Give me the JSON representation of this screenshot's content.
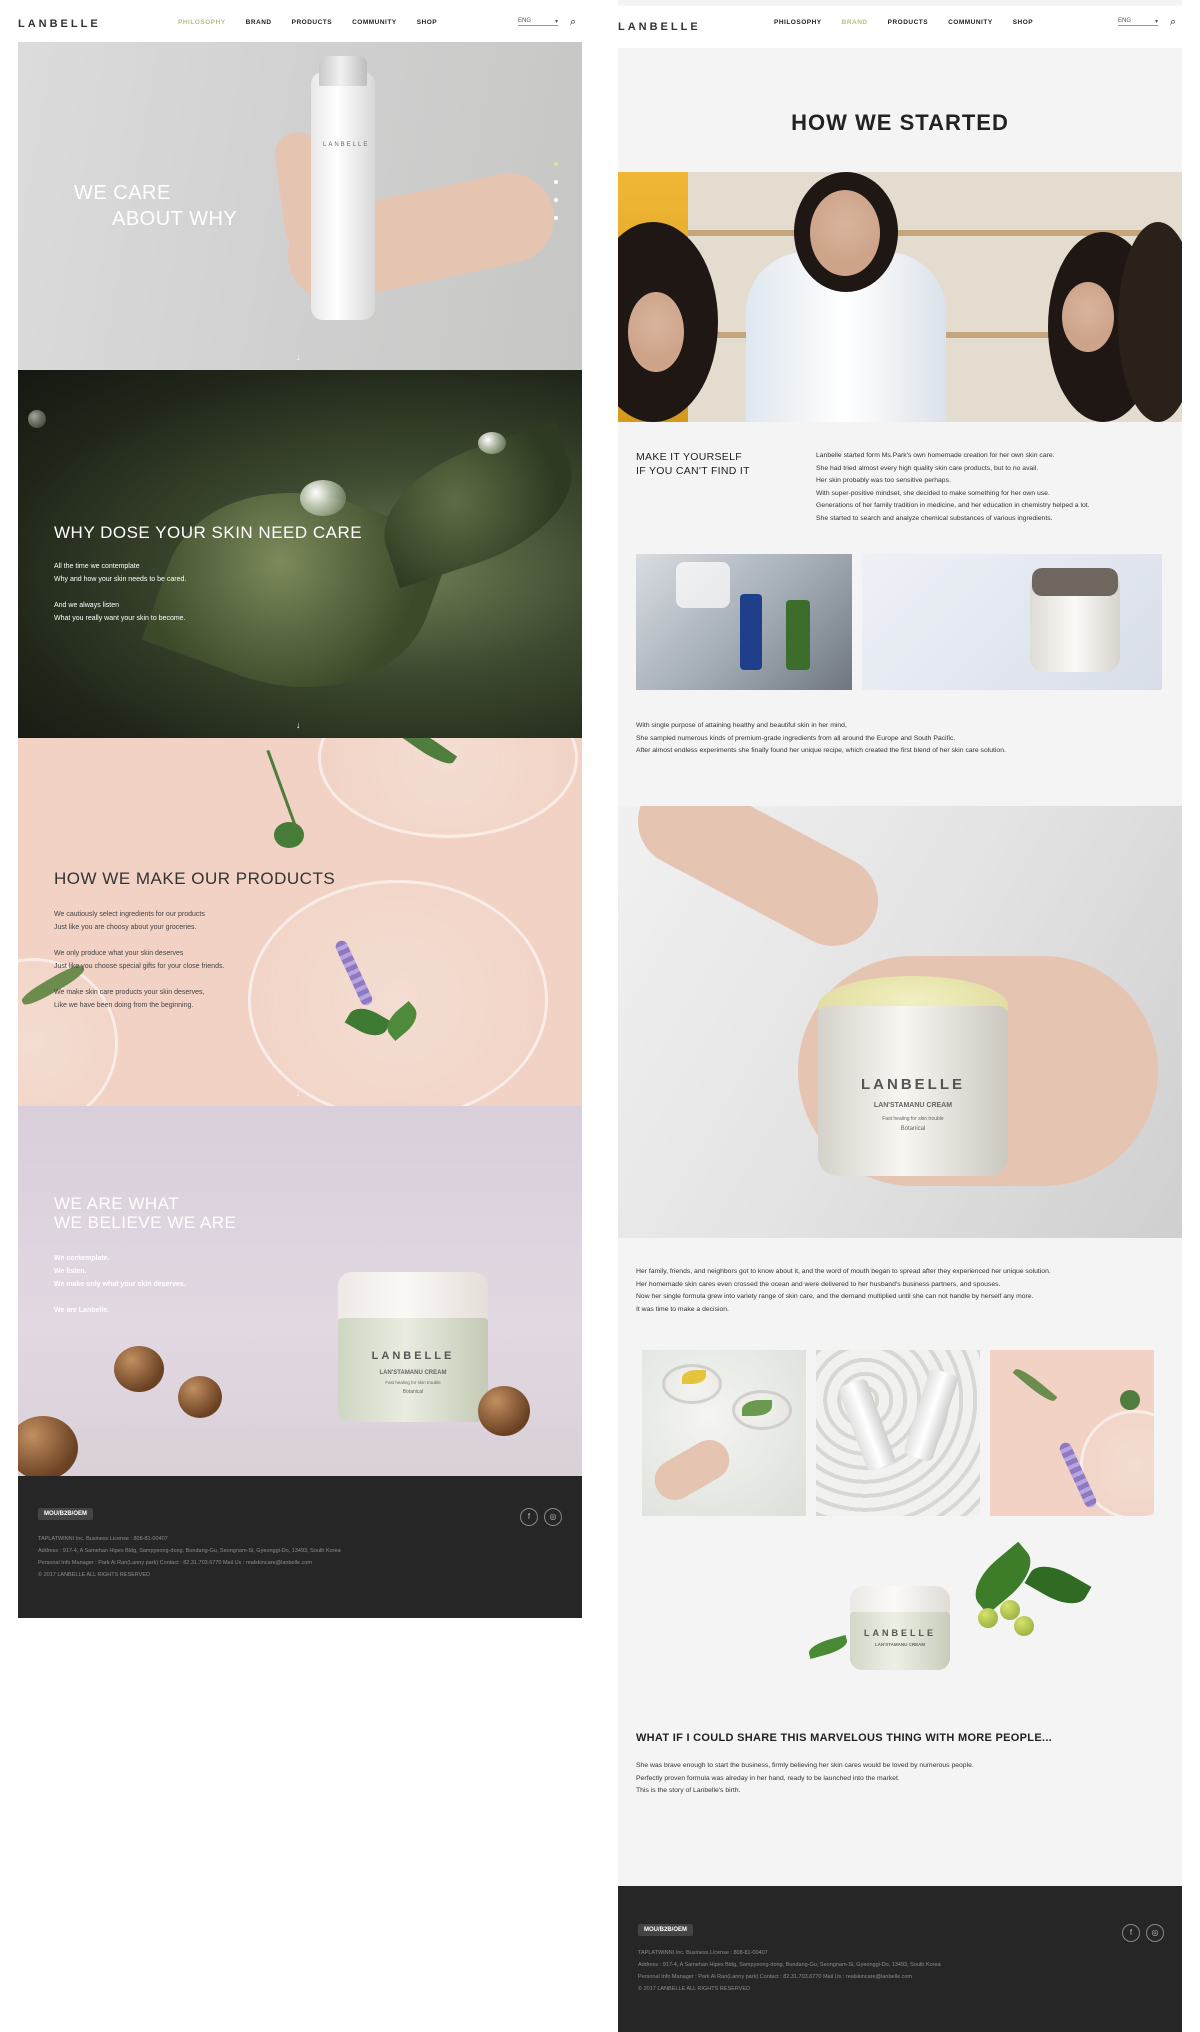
{
  "left": {
    "header": {
      "logo": "LANBELLE",
      "nav": [
        "PHILOSOPHY",
        "BRAND",
        "PRODUCTS",
        "COMMUNITY",
        "SHOP"
      ],
      "active_nav": "PHILOSOPHY",
      "lang": "ENG",
      "lang_caret": "▾",
      "search_icon": "⌕"
    },
    "hero": {
      "title_line1": "WE CARE",
      "title_line2": "ABOUT WHY",
      "bottle_brand": "LANBELLE",
      "scroll_arrow": "↓"
    },
    "why": {
      "title": "WHY DOSE YOUR SKIN NEED CARE",
      "lines": [
        "All the time we contemplate",
        "Why and how your skin needs to be cared.",
        "",
        "And we always listen",
        "What you really want your skin to become."
      ],
      "scroll_arrow": "↓"
    },
    "make": {
      "title": "HOW WE MAKE OUR PRODUCTS",
      "lines": [
        "We cautiously select ingredients for our products",
        "Just like you are choosy about your groceries.",
        "",
        "We only produce what your skin deserves",
        "Just like you choose special gifts for your close friends.",
        "",
        "We make skin care products your skin deserves,",
        "Like we have been doing from the beginning."
      ],
      "scroll_arrow": "↓"
    },
    "believe": {
      "title_line1": "WE ARE WHAT",
      "title_line2": "WE BELIEVE WE ARE",
      "lines": [
        "We contemplate.",
        "We listen.",
        "We make only what your skin deserves.",
        "",
        "We are Lanbelle."
      ],
      "jar_brand": "LANBELLE",
      "jar_name": "LAN'STAMANU CREAM",
      "jar_sub": "Fast healing for skin trouble",
      "jar_tag": "Botanical"
    },
    "footer": {
      "badge": "MOU/B2B/OEM",
      "line1": "TAPLATWINNI Inc.     Business License : 808-81-00407",
      "line2": "Address : 917-4, A Samehan Hipex Bldg, Sampyeong-dong, Bundang-Gu, Seongnam-Si, Gyeonggi-Do, 13493, South Korea",
      "line3": "Personal Info Manager : Park Ai Ran(Lanny park)     Contact : 82.31.703.6770     Mail Us : realskincare@lanbelle.com",
      "line4": "© 2017 LANBELLE ALL RIGHTS RESERVED",
      "social1": "f",
      "social2": "◎"
    }
  },
  "right": {
    "header": {
      "logo": "LANBELLE",
      "nav": [
        "PHILOSOPHY",
        "BRAND",
        "PRODUCTS",
        "COMMUNITY",
        "SHOP"
      ],
      "active_nav": "BRAND",
      "lang": "ENG",
      "lang_caret": "▾",
      "search_icon": "⌕"
    },
    "title": "HOW WE STARTED",
    "make_heading_line1": "MAKE IT YOURSELF",
    "make_heading_line2": "IF YOU CAN'T FIND IT",
    "intro_lines": [
      "Lanbelle started form Ms.Park's own homemade creation for her own skin care.",
      "She had tried almost every high quality skin care products, but to no avail.",
      "Her skin probably was too sensitive perhaps.",
      "With super-positive mindset, she decided to make something for her own use.",
      "Generations of her family tradition in medicine, and her education in chemistry helped a lot.",
      "She started to search and analyze chemical substances of various ingredients."
    ],
    "purpose_lines": [
      "With single purpose of attaining healthy and beautiful skin in her mind,",
      "She sampled numerous kinds of premium-grade ingredients from all around the Europe and South Pacific.",
      "After almost endless experiments she finally found her unique recipe, which created the first blend of her skin care solution."
    ],
    "big_jar": {
      "brand": "LANBELLE",
      "name": "LAN'STAMANU CREAM",
      "sub": "Fast healing for skin trouble",
      "tag": "Botanical"
    },
    "spread_lines": [
      "Her family, friends, and neighbors got to know about it, and the word of mouth began to spread after they experienced her unique solution.",
      "Her homemade skin cares even crossed the ocean and were delivered to her husband's business partners, and spouses.",
      "Now her single formula grew into variety range of skin care, and the demand multiplied until she can not handle by herself any more.",
      "It was time to make a decision."
    ],
    "small_jar": {
      "brand": "LANBELLE",
      "name": "LAN'STAMANU CREAM"
    },
    "share_heading": "WHAT IF I COULD SHARE THIS MARVELOUS THING WITH MORE PEOPLE...",
    "share_lines": [
      "She was brave enough to start the business, firmly believing her skin cares would be loved by numerous people.",
      "Perfectly proven formula was alreday in her hand, ready to be launched into the market.",
      "This is the story of Lanbelle's birth."
    ],
    "footer": {
      "badge": "MOU/B2B/OEM",
      "line1": "TAPLATWINNI Inc.     Business License : 808-81-00407",
      "line2": "Address : 917-4, A Samehan Hipex Bldg, Sampyeong-dong, Bundang-Gu, Seongnam-Si, Gyeonggi-Do, 13493, South Korea",
      "line3": "Personal Info Manager : Park Ai Ran(Lanny park)     Contact : 82.31.703.6770     Mail Us : realskincare@lanbelle.com",
      "line4": "© 2017 LANBELLE ALL RIGHTS RESERVED",
      "social1": "f",
      "social2": "◎"
    }
  },
  "colors": {
    "active_nav": "#b8c07a",
    "footer_bg": "#262626",
    "peach_bg": "#f1d2c4",
    "lavender_bg": "#ddd3dd",
    "forest_bg": "#2a3320"
  }
}
